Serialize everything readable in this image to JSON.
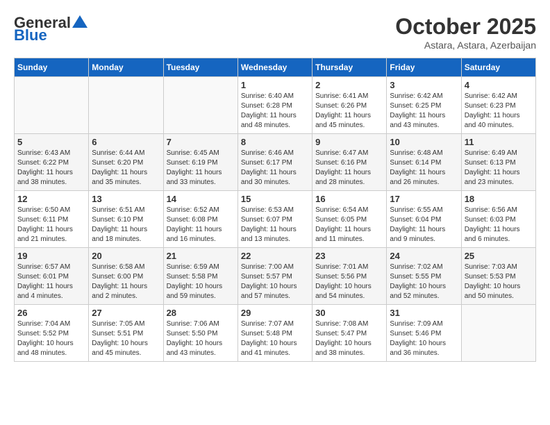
{
  "header": {
    "logo_general": "General",
    "logo_blue": "Blue",
    "month_title": "October 2025",
    "location": "Astara, Astara, Azerbaijan"
  },
  "weekdays": [
    "Sunday",
    "Monday",
    "Tuesday",
    "Wednesday",
    "Thursday",
    "Friday",
    "Saturday"
  ],
  "weeks": [
    [
      {
        "day": "",
        "info": ""
      },
      {
        "day": "",
        "info": ""
      },
      {
        "day": "",
        "info": ""
      },
      {
        "day": "1",
        "info": "Sunrise: 6:40 AM\nSunset: 6:28 PM\nDaylight: 11 hours\nand 48 minutes."
      },
      {
        "day": "2",
        "info": "Sunrise: 6:41 AM\nSunset: 6:26 PM\nDaylight: 11 hours\nand 45 minutes."
      },
      {
        "day": "3",
        "info": "Sunrise: 6:42 AM\nSunset: 6:25 PM\nDaylight: 11 hours\nand 43 minutes."
      },
      {
        "day": "4",
        "info": "Sunrise: 6:42 AM\nSunset: 6:23 PM\nDaylight: 11 hours\nand 40 minutes."
      }
    ],
    [
      {
        "day": "5",
        "info": "Sunrise: 6:43 AM\nSunset: 6:22 PM\nDaylight: 11 hours\nand 38 minutes."
      },
      {
        "day": "6",
        "info": "Sunrise: 6:44 AM\nSunset: 6:20 PM\nDaylight: 11 hours\nand 35 minutes."
      },
      {
        "day": "7",
        "info": "Sunrise: 6:45 AM\nSunset: 6:19 PM\nDaylight: 11 hours\nand 33 minutes."
      },
      {
        "day": "8",
        "info": "Sunrise: 6:46 AM\nSunset: 6:17 PM\nDaylight: 11 hours\nand 30 minutes."
      },
      {
        "day": "9",
        "info": "Sunrise: 6:47 AM\nSunset: 6:16 PM\nDaylight: 11 hours\nand 28 minutes."
      },
      {
        "day": "10",
        "info": "Sunrise: 6:48 AM\nSunset: 6:14 PM\nDaylight: 11 hours\nand 26 minutes."
      },
      {
        "day": "11",
        "info": "Sunrise: 6:49 AM\nSunset: 6:13 PM\nDaylight: 11 hours\nand 23 minutes."
      }
    ],
    [
      {
        "day": "12",
        "info": "Sunrise: 6:50 AM\nSunset: 6:11 PM\nDaylight: 11 hours\nand 21 minutes."
      },
      {
        "day": "13",
        "info": "Sunrise: 6:51 AM\nSunset: 6:10 PM\nDaylight: 11 hours\nand 18 minutes."
      },
      {
        "day": "14",
        "info": "Sunrise: 6:52 AM\nSunset: 6:08 PM\nDaylight: 11 hours\nand 16 minutes."
      },
      {
        "day": "15",
        "info": "Sunrise: 6:53 AM\nSunset: 6:07 PM\nDaylight: 11 hours\nand 13 minutes."
      },
      {
        "day": "16",
        "info": "Sunrise: 6:54 AM\nSunset: 6:05 PM\nDaylight: 11 hours\nand 11 minutes."
      },
      {
        "day": "17",
        "info": "Sunrise: 6:55 AM\nSunset: 6:04 PM\nDaylight: 11 hours\nand 9 minutes."
      },
      {
        "day": "18",
        "info": "Sunrise: 6:56 AM\nSunset: 6:03 PM\nDaylight: 11 hours\nand 6 minutes."
      }
    ],
    [
      {
        "day": "19",
        "info": "Sunrise: 6:57 AM\nSunset: 6:01 PM\nDaylight: 11 hours\nand 4 minutes."
      },
      {
        "day": "20",
        "info": "Sunrise: 6:58 AM\nSunset: 6:00 PM\nDaylight: 11 hours\nand 2 minutes."
      },
      {
        "day": "21",
        "info": "Sunrise: 6:59 AM\nSunset: 5:58 PM\nDaylight: 10 hours\nand 59 minutes."
      },
      {
        "day": "22",
        "info": "Sunrise: 7:00 AM\nSunset: 5:57 PM\nDaylight: 10 hours\nand 57 minutes."
      },
      {
        "day": "23",
        "info": "Sunrise: 7:01 AM\nSunset: 5:56 PM\nDaylight: 10 hours\nand 54 minutes."
      },
      {
        "day": "24",
        "info": "Sunrise: 7:02 AM\nSunset: 5:55 PM\nDaylight: 10 hours\nand 52 minutes."
      },
      {
        "day": "25",
        "info": "Sunrise: 7:03 AM\nSunset: 5:53 PM\nDaylight: 10 hours\nand 50 minutes."
      }
    ],
    [
      {
        "day": "26",
        "info": "Sunrise: 7:04 AM\nSunset: 5:52 PM\nDaylight: 10 hours\nand 48 minutes."
      },
      {
        "day": "27",
        "info": "Sunrise: 7:05 AM\nSunset: 5:51 PM\nDaylight: 10 hours\nand 45 minutes."
      },
      {
        "day": "28",
        "info": "Sunrise: 7:06 AM\nSunset: 5:50 PM\nDaylight: 10 hours\nand 43 minutes."
      },
      {
        "day": "29",
        "info": "Sunrise: 7:07 AM\nSunset: 5:48 PM\nDaylight: 10 hours\nand 41 minutes."
      },
      {
        "day": "30",
        "info": "Sunrise: 7:08 AM\nSunset: 5:47 PM\nDaylight: 10 hours\nand 38 minutes."
      },
      {
        "day": "31",
        "info": "Sunrise: 7:09 AM\nSunset: 5:46 PM\nDaylight: 10 hours\nand 36 minutes."
      },
      {
        "day": "",
        "info": ""
      }
    ]
  ]
}
